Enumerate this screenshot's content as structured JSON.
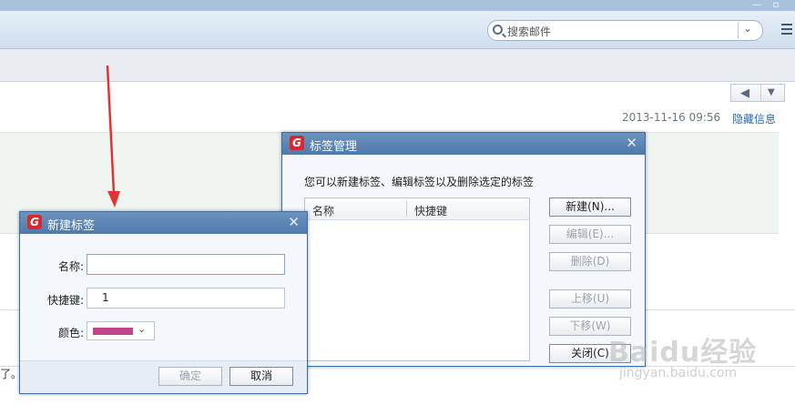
{
  "search": {
    "placeholder": "搜索邮件"
  },
  "mail": {
    "date": "2013-11-16 09:56",
    "hide_info": "隐藏信息",
    "fragment": "了。"
  },
  "tag_manager": {
    "title": "标签管理",
    "description": "您可以新建标签、编辑标签以及删除选定的标签",
    "columns": [
      "名称",
      "快捷键"
    ],
    "buttons": {
      "new": "新建(N)...",
      "edit": "编辑(E)...",
      "delete": "删除(D)",
      "move_up": "上移(U)",
      "move_down": "下移(W)",
      "close": "关闭(C)"
    }
  },
  "new_tag": {
    "title": "新建标签",
    "name_label": "名称:",
    "name_value": "",
    "shortcut_label": "快捷键:",
    "shortcut_value": "1",
    "color_label": "颜色:",
    "color_value": "#c2458c",
    "ok": "确定",
    "cancel": "取消"
  },
  "watermark": {
    "brand": "Baidu经验",
    "url": "jingyan.baidu.com"
  },
  "colors": {
    "titlebar": "#4f79ab",
    "accent_link": "#2a6bb3",
    "arrow": "#e8302f"
  }
}
